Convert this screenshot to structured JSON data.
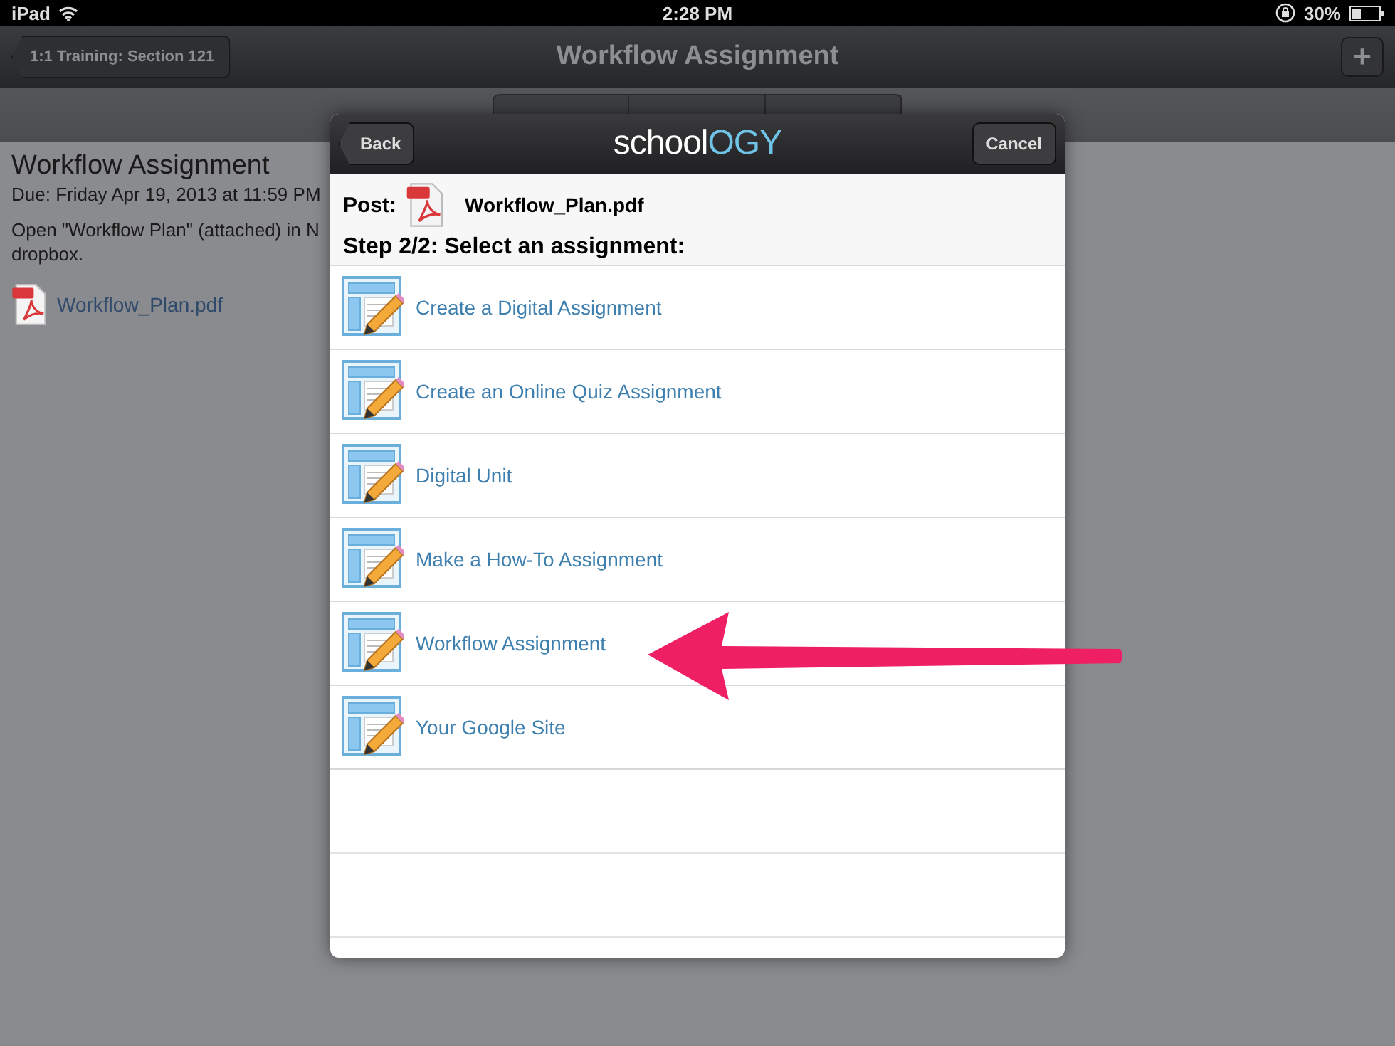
{
  "status_bar": {
    "device": "iPad",
    "time": "2:28 PM",
    "battery": "30%"
  },
  "nav_bar": {
    "back": "1:1 Training: Section 121",
    "title": "Workflow Assignment",
    "add": "+"
  },
  "assignment": {
    "title": "Workflow Assignment",
    "due": "Due: Friday Apr 19, 2013 at 11:59 PM",
    "description": [
      "Open \"Workflow Plan\" (attached) in N",
      "dropbox."
    ],
    "attachment": "Workflow_Plan.pdf"
  },
  "dialog": {
    "back": "Back",
    "logo_start": "school",
    "logo_end": "OGY",
    "cancel": "Cancel",
    "post_label": "Post:",
    "file": "Workflow_Plan.pdf",
    "step": "Step 2/2: Select an assignment:",
    "items": [
      {
        "label": "Create a Digital Assignment"
      },
      {
        "label": "Create an Online Quiz Assignment"
      },
      {
        "label": "Digital Unit"
      },
      {
        "label": "Make a How-To Assignment"
      },
      {
        "label": "Workflow Assignment"
      },
      {
        "label": "Your Google Site"
      }
    ]
  }
}
